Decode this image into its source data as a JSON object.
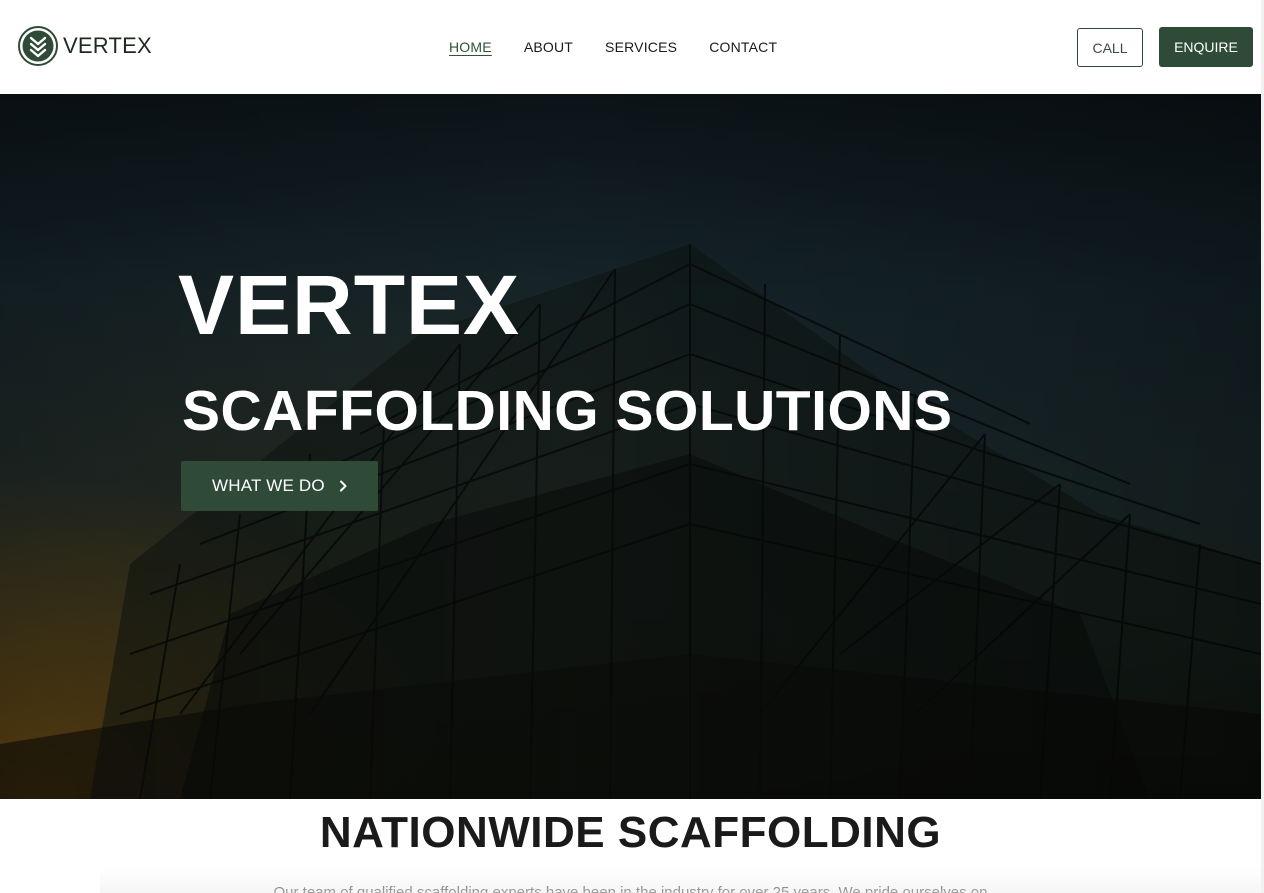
{
  "brand": {
    "name": "VERTEX",
    "accent_color": "#2f4b38",
    "logo_icon": "double-chevron-down-icon"
  },
  "nav": {
    "items": [
      {
        "label": "HOME",
        "active": true
      },
      {
        "label": "ABOUT",
        "active": false
      },
      {
        "label": "SERVICES",
        "active": false
      },
      {
        "label": "CONTACT",
        "active": false
      }
    ]
  },
  "header_actions": {
    "call_label": "CALL",
    "enquire_label": "ENQUIRE"
  },
  "hero": {
    "title": "VERTEX",
    "subtitle": "SCAFFOLDING SOLUTIONS",
    "cta_label": "WHAT WE DO",
    "cta_icon": "chevron-right-icon",
    "background": "scaffolding-silhouette-photo"
  },
  "section": {
    "title": "NATIONWIDE SCAFFOLDING",
    "body": "Our team of qualified scaffolding experts have been in the industry for over 25 years. We pride ourselves on"
  }
}
